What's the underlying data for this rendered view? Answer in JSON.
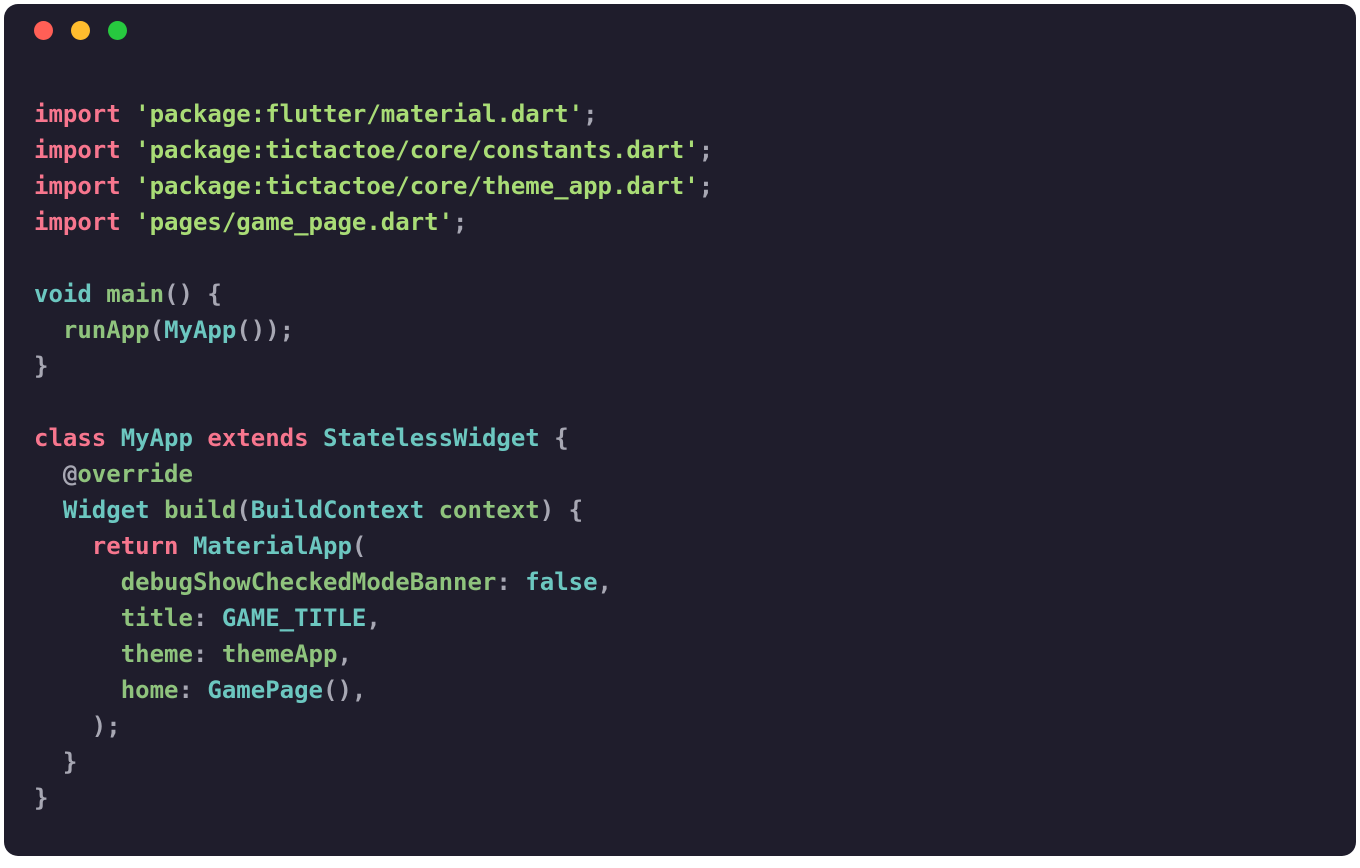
{
  "colors": {
    "bg": "#1f1d2c",
    "keyword": "#f7768e",
    "string": "#a9dc76",
    "type": "#6cc7c0",
    "identifier": "#8fc37d",
    "symbol": "#a7a7b3",
    "text": "#cfd0da",
    "traffic_red": "#ff5f56",
    "traffic_yellow": "#ffbd2e",
    "traffic_green": "#27c93f"
  },
  "code": {
    "language": "dart",
    "tokens": [
      [
        [
          "import",
          "kw"
        ],
        [
          " ",
          "sym"
        ],
        [
          "'package:flutter/material.dart'",
          "str"
        ],
        [
          ";",
          "sym"
        ]
      ],
      [
        [
          "import",
          "kw"
        ],
        [
          " ",
          "sym"
        ],
        [
          "'package:tictactoe/core/constants.dart'",
          "str"
        ],
        [
          ";",
          "sym"
        ]
      ],
      [
        [
          "import",
          "kw"
        ],
        [
          " ",
          "sym"
        ],
        [
          "'package:tictactoe/core/theme_app.dart'",
          "str"
        ],
        [
          ";",
          "sym"
        ]
      ],
      [
        [
          "import",
          "kw"
        ],
        [
          " ",
          "sym"
        ],
        [
          "'pages/game_page.dart'",
          "str"
        ],
        [
          ";",
          "sym"
        ]
      ],
      [],
      [
        [
          "void",
          "ty"
        ],
        [
          " ",
          "sym"
        ],
        [
          "main",
          "id"
        ],
        [
          "() {",
          "sym"
        ]
      ],
      [
        [
          "  ",
          "sym"
        ],
        [
          "runApp",
          "id"
        ],
        [
          "(",
          "sym"
        ],
        [
          "MyApp",
          "ty"
        ],
        [
          "());",
          "sym"
        ]
      ],
      [
        [
          "}",
          "sym"
        ]
      ],
      [],
      [
        [
          "class",
          "kw"
        ],
        [
          " ",
          "sym"
        ],
        [
          "MyApp",
          "ty"
        ],
        [
          " ",
          "sym"
        ],
        [
          "extends",
          "kw"
        ],
        [
          " ",
          "sym"
        ],
        [
          "StatelessWidget",
          "ty"
        ],
        [
          " {",
          "sym"
        ]
      ],
      [
        [
          "  @",
          "sym"
        ],
        [
          "override",
          "id"
        ]
      ],
      [
        [
          "  ",
          "sym"
        ],
        [
          "Widget",
          "ty"
        ],
        [
          " ",
          "sym"
        ],
        [
          "build",
          "id"
        ],
        [
          "(",
          "sym"
        ],
        [
          "BuildContext",
          "ty"
        ],
        [
          " ",
          "sym"
        ],
        [
          "context",
          "id"
        ],
        [
          ") {",
          "sym"
        ]
      ],
      [
        [
          "    ",
          "sym"
        ],
        [
          "return",
          "kw"
        ],
        [
          " ",
          "sym"
        ],
        [
          "MaterialApp",
          "ty"
        ],
        [
          "(",
          "sym"
        ]
      ],
      [
        [
          "      ",
          "sym"
        ],
        [
          "debugShowCheckedModeBanner",
          "id"
        ],
        [
          ": ",
          "sym"
        ],
        [
          "false",
          "ty"
        ],
        [
          ",",
          "sym"
        ]
      ],
      [
        [
          "      ",
          "sym"
        ],
        [
          "title",
          "id"
        ],
        [
          ": ",
          "sym"
        ],
        [
          "GAME_TITLE",
          "ty"
        ],
        [
          ",",
          "sym"
        ]
      ],
      [
        [
          "      ",
          "sym"
        ],
        [
          "theme",
          "id"
        ],
        [
          ": ",
          "sym"
        ],
        [
          "themeApp",
          "id"
        ],
        [
          ",",
          "sym"
        ]
      ],
      [
        [
          "      ",
          "sym"
        ],
        [
          "home",
          "id"
        ],
        [
          ": ",
          "sym"
        ],
        [
          "GamePage",
          "ty"
        ],
        [
          "(),",
          "sym"
        ]
      ],
      [
        [
          "    );",
          "sym"
        ]
      ],
      [
        [
          "  }",
          "sym"
        ]
      ],
      [
        [
          "}",
          "sym"
        ]
      ]
    ],
    "plain": "import 'package:flutter/material.dart';\nimport 'package:tictactoe/core/constants.dart';\nimport 'package:tictactoe/core/theme_app.dart';\nimport 'pages/game_page.dart';\n\nvoid main() {\n  runApp(MyApp());\n}\n\nclass MyApp extends StatelessWidget {\n  @override\n  Widget build(BuildContext context) {\n    return MaterialApp(\n      debugShowCheckedModeBanner: false,\n      title: GAME_TITLE,\n      theme: themeApp,\n      home: GamePage(),\n    );\n  }\n}"
  }
}
